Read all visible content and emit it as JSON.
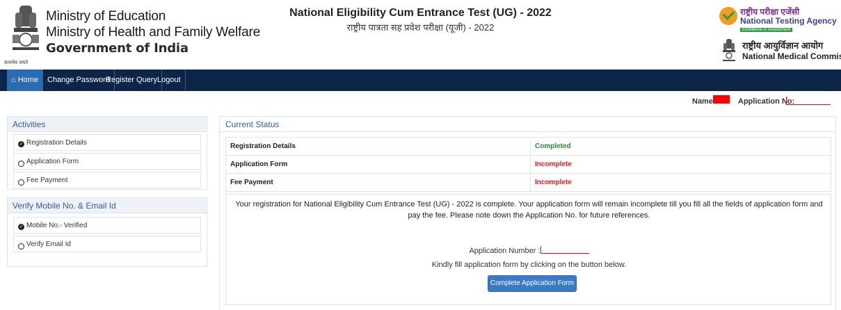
{
  "header": {
    "ministries": [
      "Ministry of Education",
      "Ministry of Health and Family Welfare"
    ],
    "government": "Government of India",
    "emblem_motto": "सत्यमेव जयते",
    "exam_title_en": "National Eligibility Cum Entrance Test (UG) - 2022",
    "exam_title_hi": "राष्ट्रीय पात्रता सह प्रवेश परीक्षा (यूजी) - 2022",
    "nta_hi": "राष्ट्रीय परीक्षा एजेंसी",
    "nta_en": "National Testing Agency",
    "nta_tagline": "Excellence in Assessment",
    "nmc_hi": "राष्ट्रीय आयुर्विज्ञान आयोग",
    "nmc_en": "National Medical Commission"
  },
  "navbar": {
    "home": "Home",
    "change_password": "Change Password",
    "register_query": "Register Query",
    "logout": "Logout"
  },
  "user": {
    "name_label": "Name:",
    "application_label": "Application No:"
  },
  "activities": {
    "title": "Activities",
    "items": [
      "Registration Details",
      "Application Form",
      "Fee Payment"
    ]
  },
  "verify": {
    "title": "Verify Mobile No. & Email Id",
    "items": [
      "Mobile No.- Verified",
      "Verify Email Id"
    ]
  },
  "current_status": {
    "title": "Current Status",
    "rows": [
      {
        "label": "Registration Details",
        "status": "Completed"
      },
      {
        "label": "Application Form",
        "status": "Incomplete"
      },
      {
        "label": "Fee Payment",
        "status": "Incomplete"
      }
    ],
    "message": "Your registration for National Eligibility Cum Entrance Test (UG) - 2022 is complete. Your application form will remain incomplete till you fill all the fields of application form and pay the fee. Please note down the Application No. for future references.",
    "application_number_label": "Application Number :",
    "instruction": "Kindly fill application form by clicking on the button below.",
    "button": "Complete Application Form"
  },
  "colors": {
    "navbar": "#0d2548",
    "home_active": "#2b6cb0",
    "completed": "#2d8a2d",
    "incomplete": "#e02020",
    "panel_title": "#2f5f9a"
  }
}
